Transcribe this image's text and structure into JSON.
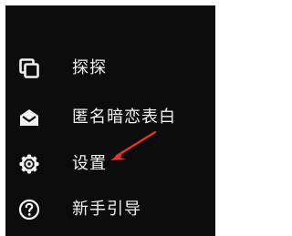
{
  "menu": {
    "items": [
      {
        "id": "tantan",
        "label": "探探",
        "icon": "cards-stack-icon"
      },
      {
        "id": "anonymous-confession",
        "label": "匿名暗恋表白",
        "icon": "envelope-open-icon"
      },
      {
        "id": "settings",
        "label": "设置",
        "icon": "gear-icon"
      },
      {
        "id": "guide",
        "label": "新手引导",
        "icon": "question-circle-icon"
      }
    ]
  },
  "annotation": {
    "arrow_color": "#e8332a",
    "points_to": "settings"
  },
  "colors": {
    "panel_background": "#0c0c0c",
    "text": "#f2f2f2",
    "icon": "#f2f2f2"
  }
}
